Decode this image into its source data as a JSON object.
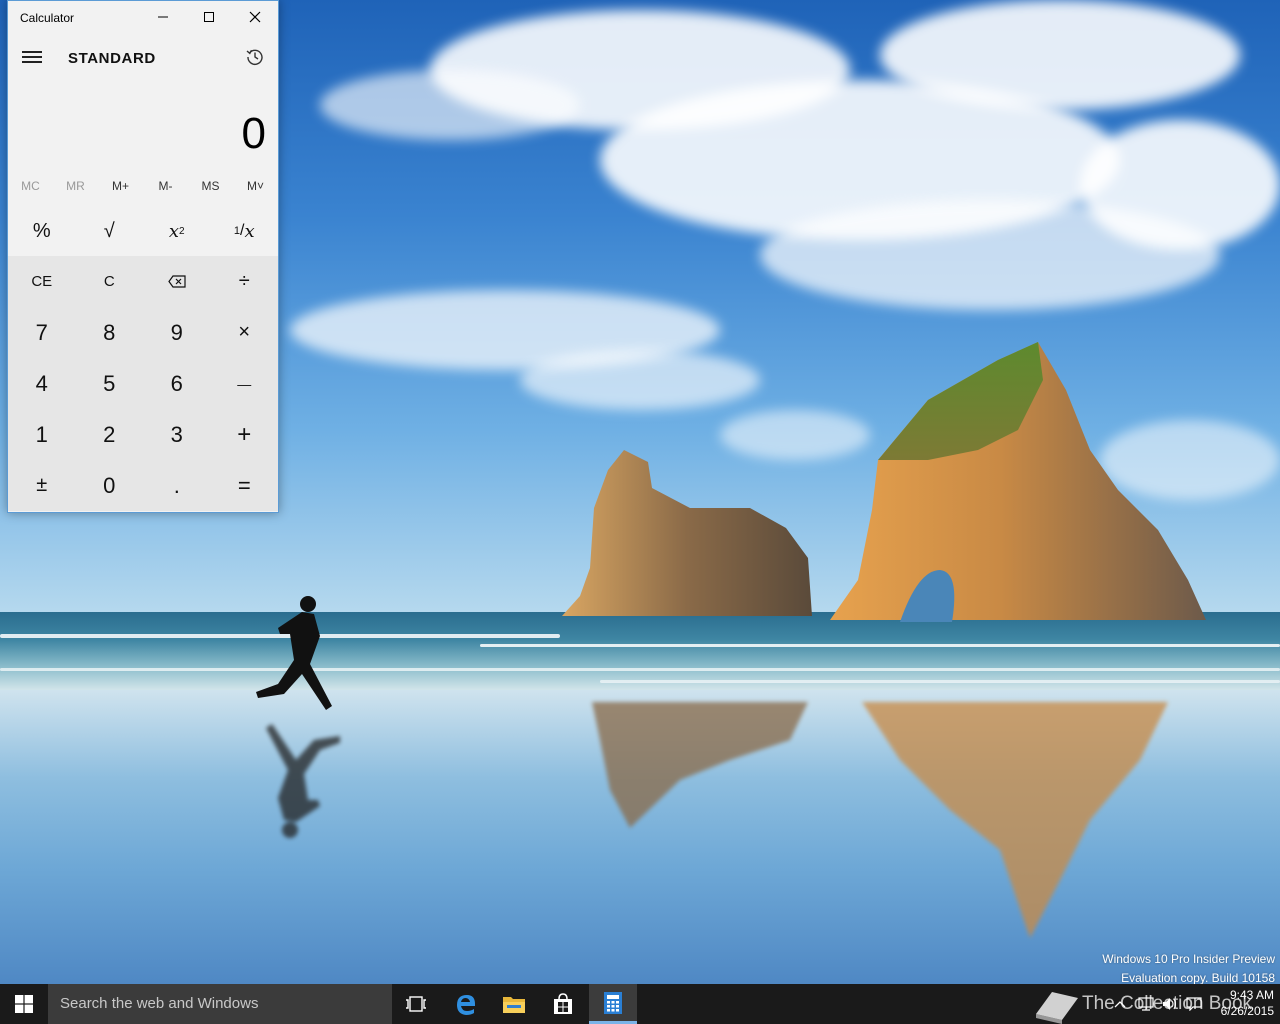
{
  "calculator": {
    "window_title": "Calculator",
    "mode": "STANDARD",
    "display_value": "0",
    "memory_buttons": [
      {
        "label": "MC",
        "enabled": false
      },
      {
        "label": "MR",
        "enabled": false
      },
      {
        "label": "M+",
        "enabled": true
      },
      {
        "label": "M-",
        "enabled": true
      },
      {
        "label": "MS",
        "enabled": true
      },
      {
        "label": "M˅",
        "enabled": true
      }
    ],
    "keys": {
      "percent": "%",
      "sqrt": "√",
      "square_base": "x",
      "square_exp": "2",
      "recip_num": "1",
      "recip_den": "x",
      "ce": "CE",
      "c": "C",
      "backspace": "⌫",
      "divide": "÷",
      "seven": "7",
      "eight": "8",
      "nine": "9",
      "multiply": "×",
      "four": "4",
      "five": "5",
      "six": "6",
      "minus": "—",
      "one": "1",
      "two": "2",
      "three": "3",
      "plus": "+",
      "negate": "±",
      "zero": "0",
      "decimal": ".",
      "equals": "="
    },
    "icons": [
      "hamburger-icon",
      "history-icon",
      "minimize-icon",
      "maximize-icon",
      "close-icon"
    ]
  },
  "desktop": {
    "watermark_line1": "Windows 10 Pro Insider Preview",
    "watermark_line2": "Evaluation copy. Build 10158"
  },
  "taskbar": {
    "search_placeholder": "Search the web and Windows",
    "clock_time": "9:43 AM",
    "clock_date": "6/26/2015",
    "brand_text": "The Collection Book",
    "accent_color": "#7ab3e8"
  }
}
